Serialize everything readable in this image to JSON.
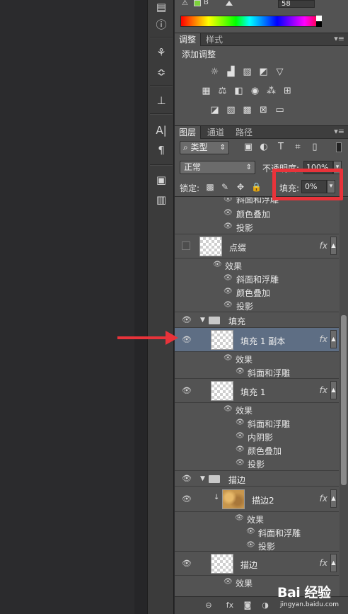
{
  "color_panel": {
    "b_label": "B",
    "b_value": "58",
    "foreground_color": "#7bd13a"
  },
  "adjustments_panel": {
    "tabs": [
      "调整",
      "样式"
    ],
    "title": "添加调整",
    "icons": [
      [
        "brightness-icon",
        "levels-icon",
        "curves-icon",
        "exposure-icon",
        "vibrance-icon"
      ],
      [
        "hue-saturation-icon",
        "color-balance-icon",
        "black-white-icon",
        "photo-filter-icon",
        "channel-mixer-icon",
        "color-lookup-icon"
      ],
      [
        "invert-icon",
        "posterize-icon",
        "threshold-icon",
        "selective-color-icon",
        "gradient-map-icon"
      ]
    ]
  },
  "layers_panel": {
    "tabs": [
      "图层",
      "通道",
      "路径"
    ],
    "kind_filter": "类型",
    "blend_mode": "正常",
    "opacity_label": "不透明度:",
    "opacity_value": "100%",
    "lock_label": "锁定:",
    "fill_label": "填充:",
    "fill_value": "0%",
    "fx_label": "fx",
    "layers": {
      "top_effects": [
        "斜面和浮雕",
        "颜色叠加",
        "投影"
      ],
      "dianzhui": {
        "name": "点缀",
        "effects_label": "效果",
        "effects": [
          "斜面和浮雕",
          "颜色叠加",
          "投影"
        ]
      },
      "group_fill": {
        "name": "填充"
      },
      "fill_copy": {
        "name": "填充 1 副本",
        "effects_label": "效果",
        "effects": [
          "斜面和浮雕"
        ]
      },
      "fill1": {
        "name": "填充 1",
        "effects_label": "效果",
        "effects": [
          "斜面和浮雕",
          "内阴影",
          "颜色叠加",
          "投影"
        ]
      },
      "group_stroke": {
        "name": "描边"
      },
      "stroke2": {
        "name": "描边2",
        "effects_label": "效果",
        "effects": [
          "斜面和浮雕",
          "投影"
        ]
      },
      "stroke": {
        "name": "描边",
        "effects_label": "效果"
      }
    }
  },
  "watermark": {
    "main": "Bai 经验",
    "sub": "jingyan.baidu.com"
  },
  "colors": {
    "highlight": "#e8333a",
    "selected_row": "#5e6e84",
    "panel_bg": "#535353"
  }
}
